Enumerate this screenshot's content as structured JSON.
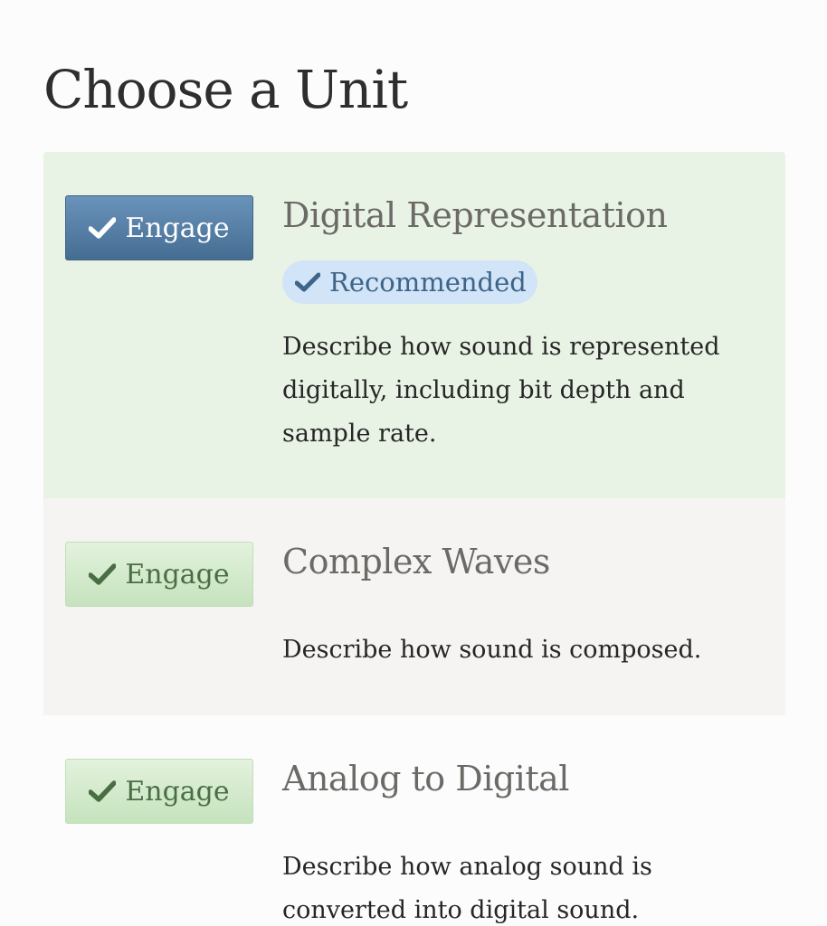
{
  "page": {
    "title": "Choose a Unit"
  },
  "units": [
    {
      "button_label": "Engage",
      "title": "Digital Representation",
      "badge": "Recommended",
      "description": "Describe how sound is represented digitally, including bit depth and sample rate."
    },
    {
      "button_label": "Engage",
      "title": "Complex Waves",
      "description": "Describe how sound is composed."
    },
    {
      "button_label": "Engage",
      "title": "Analog to Digital",
      "description": "Describe how analog sound is converted into digital sound."
    }
  ],
  "icons": {
    "button": "check-icon",
    "badge": "check-icon"
  },
  "colors": {
    "recommended_bg": "#e9f3e5",
    "alt_row_bg": "#f6f4f2",
    "primary_button": "#567fa6",
    "secondary_button": "#d4ebcd",
    "badge_bg": "#d2e4f7",
    "badge_text": "#3e6488"
  }
}
